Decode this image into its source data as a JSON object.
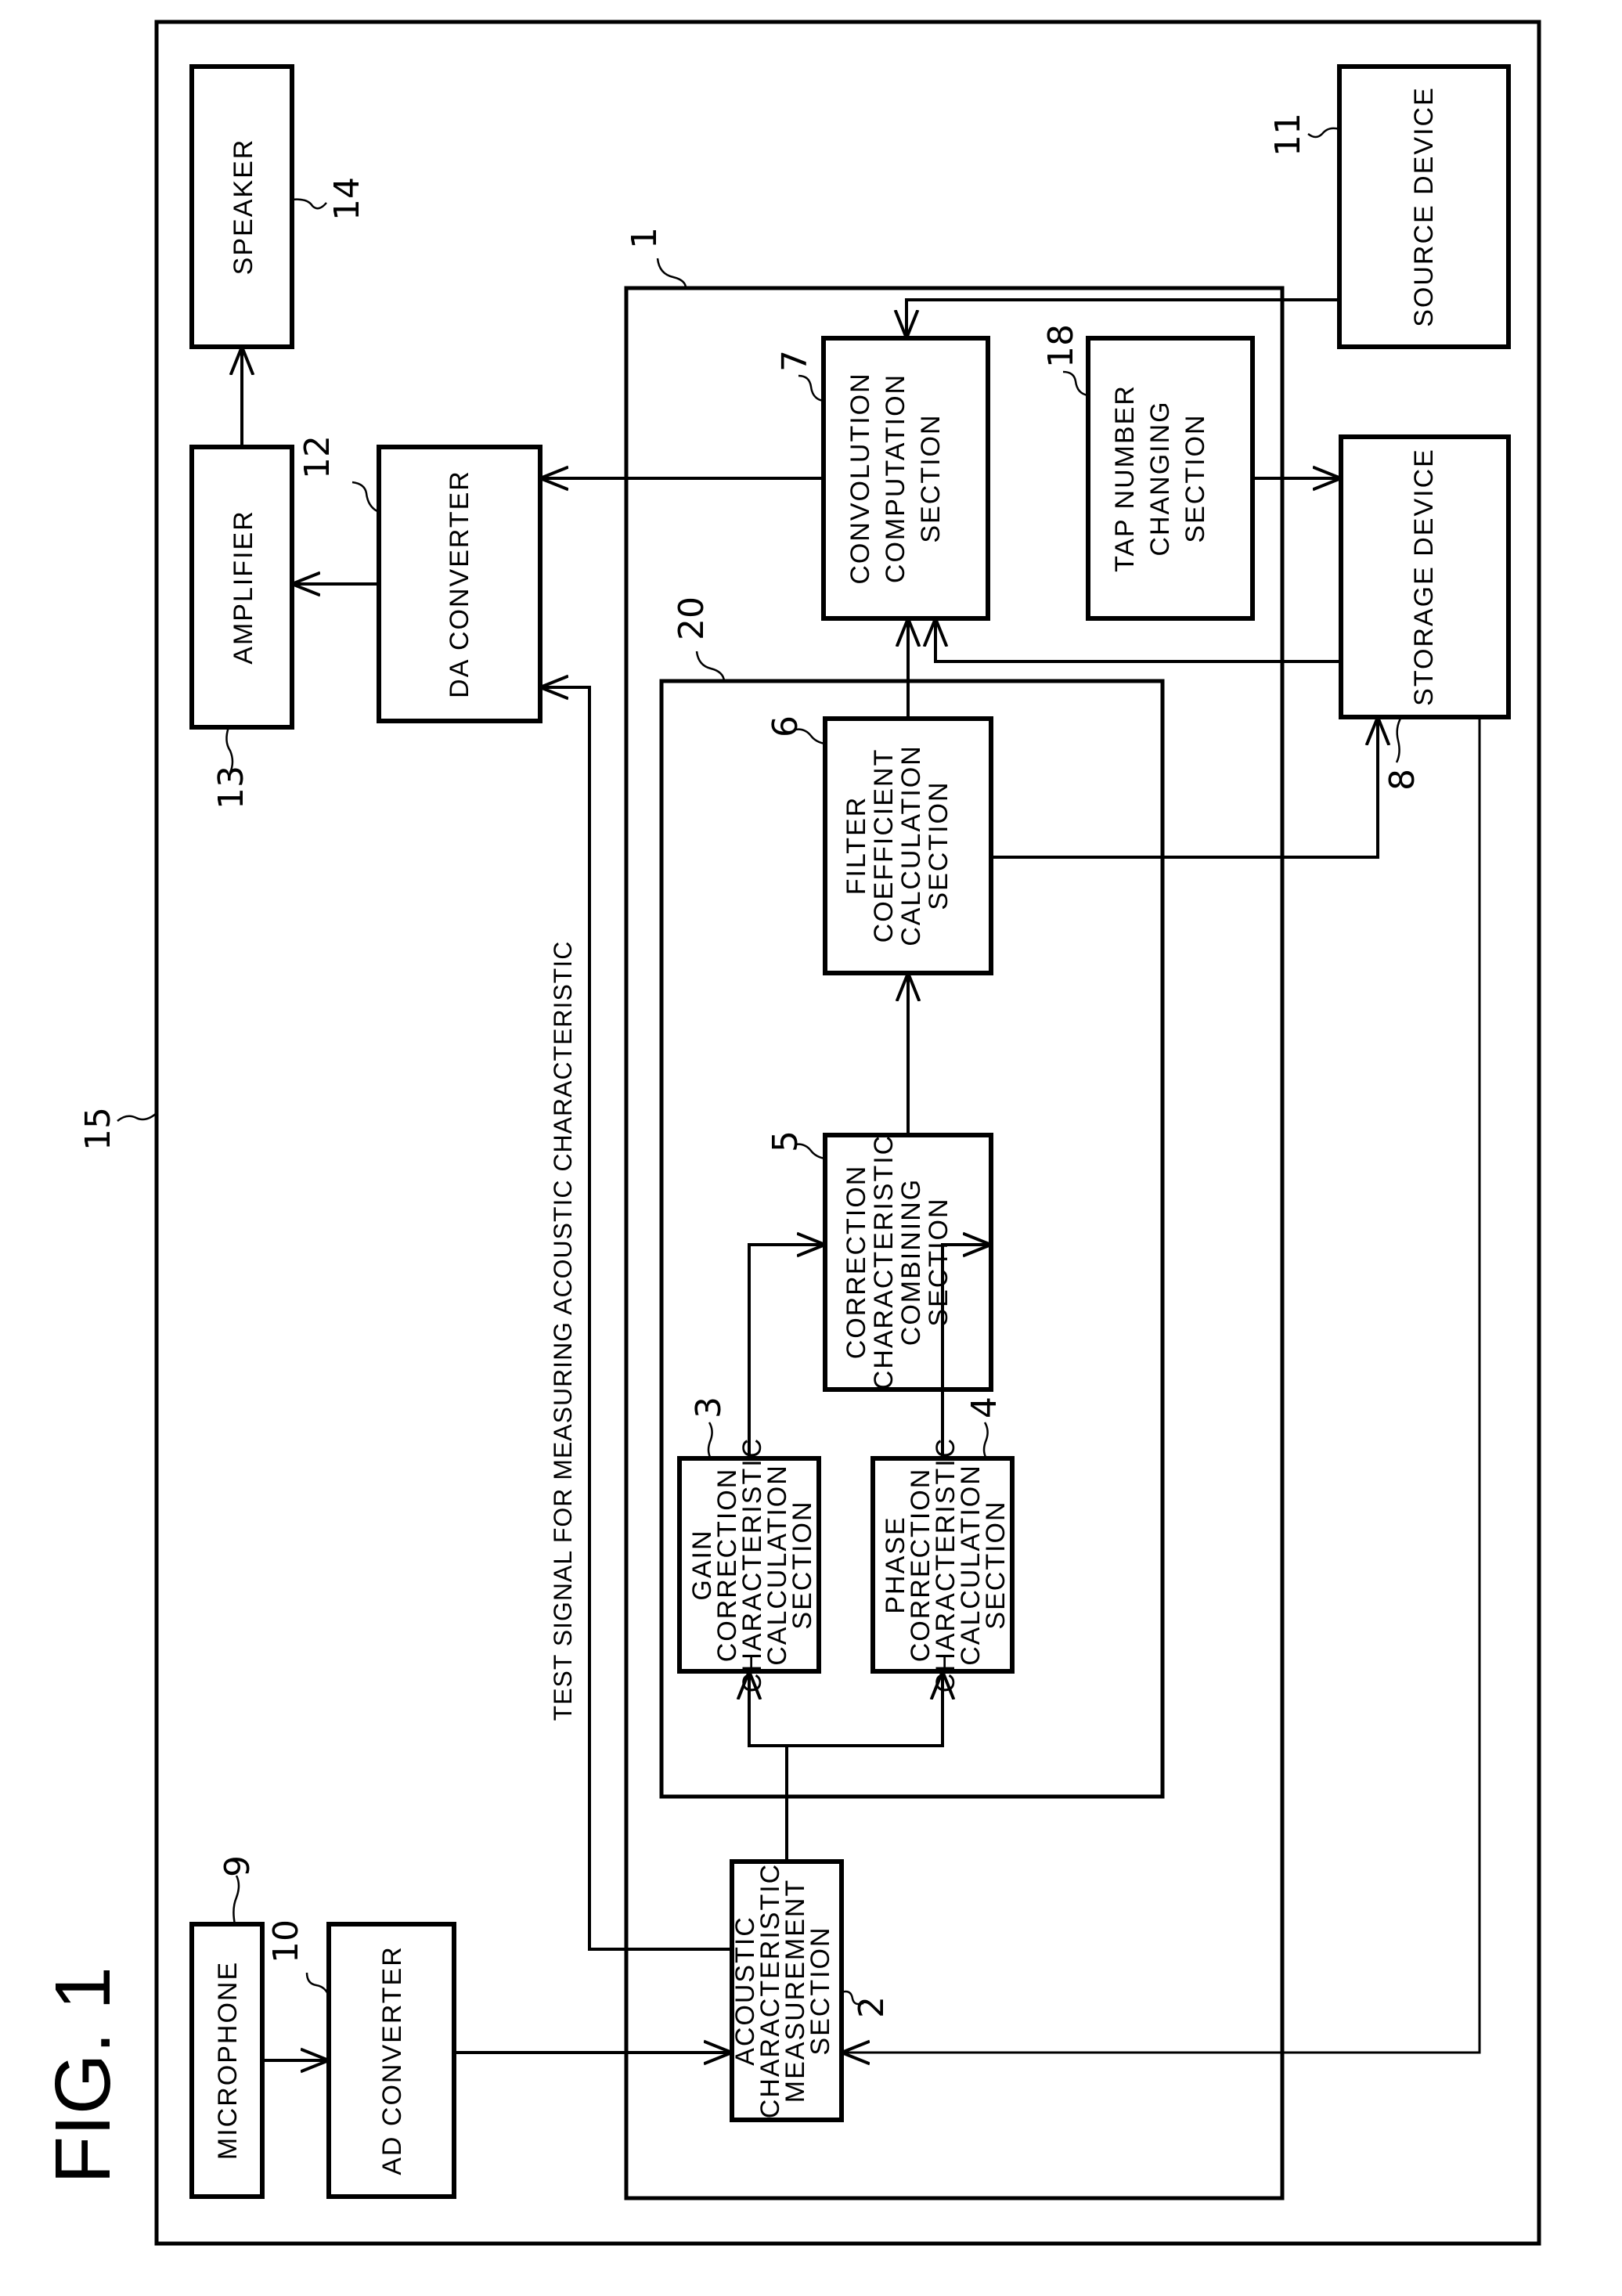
{
  "figure": {
    "title": "FIG. 1"
  },
  "system": {
    "ref": "15"
  },
  "device": {
    "ref": "1"
  },
  "correction_unit": {
    "ref": "20"
  },
  "blocks": {
    "speaker": {
      "ref": "14",
      "lines": [
        "SPEAKER"
      ]
    },
    "amplifier": {
      "ref": "13",
      "lines": [
        "AMPLIFIER"
      ]
    },
    "da_converter": {
      "ref": "12",
      "lines": [
        "DA CONVERTER"
      ]
    },
    "microphone": {
      "ref": "9",
      "lines": [
        "MICROPHONE"
      ]
    },
    "ad_converter": {
      "ref": "10",
      "lines": [
        "AD CONVERTER"
      ]
    },
    "source_device": {
      "ref": "11",
      "lines": [
        "SOURCE DEVICE"
      ]
    },
    "storage_device": {
      "ref": "8",
      "lines": [
        "STORAGE DEVICE"
      ]
    },
    "convolution": {
      "ref": "7",
      "lines": [
        "CONVOLUTION",
        "COMPUTATION",
        "SECTION"
      ]
    },
    "tap_number": {
      "ref": "18",
      "lines": [
        "TAP NUMBER",
        "CHANGING",
        "SECTION"
      ]
    },
    "filter_coefficient": {
      "ref": "6",
      "lines": [
        "FILTER",
        "COEFFICIENT",
        "CALCULATION",
        "SECTION"
      ]
    },
    "correction_combining": {
      "ref": "5",
      "lines": [
        "CORRECTION",
        "CHARACTERISTIC",
        "COMBINING",
        "SECTION"
      ]
    },
    "gain_correction": {
      "ref": "3",
      "lines": [
        "GAIN",
        "CORRECTION",
        "CHARACTERISTIC",
        "CALCULATION",
        "SECTION"
      ]
    },
    "phase_correction": {
      "ref": "4",
      "lines": [
        "PHASE",
        "CORRECTION",
        "CHARACTERISTIC",
        "CALCULATION",
        "SECTION"
      ]
    },
    "acoustic_measurement": {
      "ref": "2",
      "lines": [
        "ACOUSTIC",
        "CHARACTERISTIC",
        "MEASUREMENT",
        "SECTION"
      ]
    }
  },
  "annotations": {
    "test_signal": "TEST SIGNAL FOR MEASURING ACOUSTIC CHARACTERISTIC"
  }
}
